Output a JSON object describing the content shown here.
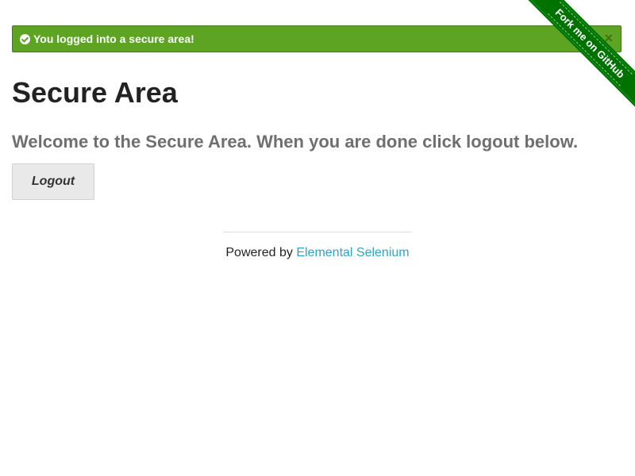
{
  "flash": {
    "icon": "check-circle-icon",
    "message": "You logged into a secure area!",
    "close_label": "×",
    "color": "#5da423"
  },
  "ribbon": {
    "label": "Fork me on GitHub",
    "color": "#007200"
  },
  "main": {
    "title": "Secure Area",
    "subheader": "Welcome to the Secure Area. When you are done click logout below.",
    "logout_label": "Logout"
  },
  "footer": {
    "prefix": "Powered by ",
    "link_text": "Elemental Selenium",
    "link_color": "#2ba6cb"
  }
}
